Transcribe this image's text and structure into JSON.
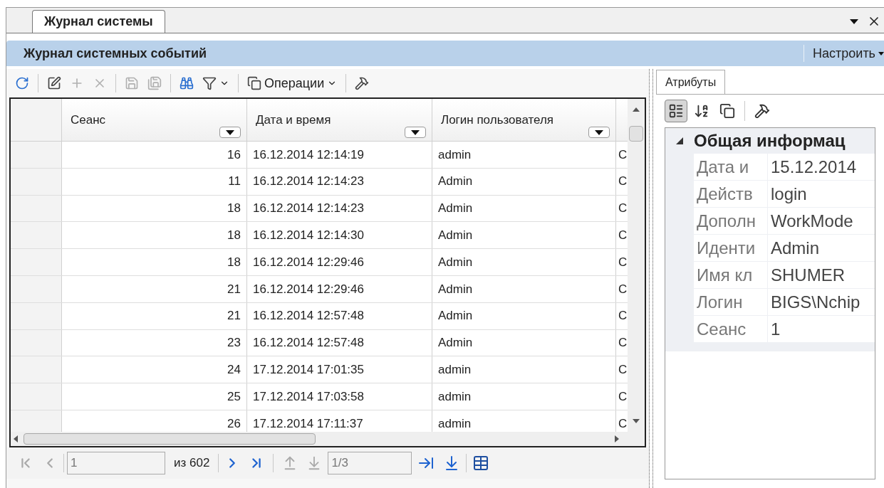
{
  "tab": {
    "label": "Журнал системы",
    "selected": true
  },
  "window_buttons": [
    {
      "kind": "menu"
    },
    {
      "kind": "close"
    }
  ],
  "header": {
    "title": "Журнал системных событий",
    "customize": "Настроить"
  },
  "toolbar": [
    {
      "kind": "refresh",
      "disabled": false
    },
    {
      "kind": "sep"
    },
    {
      "kind": "edit",
      "disabled": false
    },
    {
      "kind": "add",
      "disabled": true
    },
    {
      "kind": "delete",
      "disabled": true
    },
    {
      "kind": "sep"
    },
    {
      "kind": "save",
      "disabled": true
    },
    {
      "kind": "save-all",
      "disabled": true
    },
    {
      "kind": "sep"
    },
    {
      "kind": "find",
      "disabled": false
    },
    {
      "kind": "filter",
      "disabled": false
    },
    {
      "kind": "sep"
    },
    {
      "kind": "operations",
      "label": "Операции",
      "disabled": false
    },
    {
      "kind": "sep"
    },
    {
      "kind": "tools",
      "disabled": false
    }
  ],
  "table": {
    "columns": [
      {
        "label": "Сеанс"
      },
      {
        "label": "Дата и время"
      },
      {
        "label": "Логин пользователя"
      }
    ],
    "rows": [
      {
        "session": "16",
        "datetime": "16.12.2014 12:14:19",
        "login": "admin",
        "column_4": "С"
      },
      {
        "session": "11",
        "datetime": "16.12.2014 12:14:23",
        "login": "Admin",
        "column_4": "С"
      },
      {
        "session": "18",
        "datetime": "16.12.2014 12:14:23",
        "login": "Admin",
        "column_4": "С"
      },
      {
        "session": "18",
        "datetime": "16.12.2014 12:14:30",
        "login": "Admin",
        "column_4": "С"
      },
      {
        "session": "18",
        "datetime": "16.12.2014 12:29:46",
        "login": "Admin",
        "column_4": "С"
      },
      {
        "session": "21",
        "datetime": "16.12.2014 12:29:46",
        "login": "Admin",
        "column_4": "С"
      },
      {
        "session": "21",
        "datetime": "16.12.2014 12:57:48",
        "login": "Admin",
        "column_4": "С"
      },
      {
        "session": "23",
        "datetime": "16.12.2014 12:57:48",
        "login": "Admin",
        "column_4": "С"
      },
      {
        "session": "24",
        "datetime": "17.12.2014 17:01:35",
        "login": "admin",
        "column_4": "С"
      },
      {
        "session": "25",
        "datetime": "17.12.2014 17:03:58",
        "login": "admin",
        "column_4": "С"
      },
      {
        "session": "26",
        "datetime": "17.12.2014 17:11:37",
        "login": "admin",
        "column_4": "С"
      }
    ]
  },
  "pager": {
    "page": "1",
    "of": "из 602",
    "subpage": "1/3",
    "buttons": [
      {
        "kind": "first",
        "disabled": true
      },
      {
        "kind": "prev",
        "disabled": true
      },
      {
        "kind": "next",
        "disabled": false
      },
      {
        "kind": "last",
        "disabled": false
      }
    ]
  },
  "side": {
    "tab": {
      "label": "Атрибуты",
      "selected": true
    },
    "toolbar": [
      {
        "kind": "categorized",
        "selected": true
      },
      {
        "kind": "alphabetical",
        "selected": false
      },
      {
        "kind": "pages",
        "selected": false
      },
      {
        "kind": "tools",
        "selected": false
      }
    ],
    "category": {
      "label": "Общая информац",
      "expanded": true
    },
    "properties": [
      {
        "name": "Дата и",
        "value": "15.12.2014"
      },
      {
        "name": "Действ",
        "value": "login"
      },
      {
        "name": "Дополн",
        "value": "WorkMode"
      },
      {
        "name": "Иденти",
        "value": "Admin"
      },
      {
        "name": "Имя кл",
        "value": "SHUMER"
      },
      {
        "name": "Логин",
        "value": "BIGS\\Nchip"
      },
      {
        "name": "Сеанс",
        "value": "1"
      }
    ]
  }
}
